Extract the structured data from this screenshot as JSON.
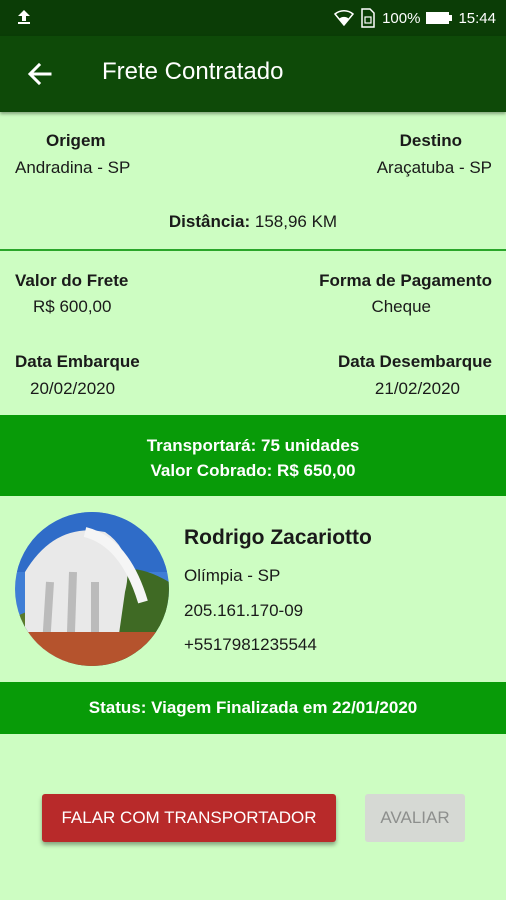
{
  "status_bar": {
    "battery": "100%",
    "time": "15:44"
  },
  "app_bar": {
    "title": "Frete Contratado"
  },
  "route": {
    "origin_label": "Origem",
    "origin_value": "Andradina - SP",
    "destination_label": "Destino",
    "destination_value": "Araçatuba - SP",
    "distance_label": "Distância:",
    "distance_value": " 158,96 KM"
  },
  "freight": {
    "value_label": "Valor do Frete",
    "value": "R$ 600,00",
    "payment_label": "Forma de Pagamento",
    "payment_value": "Cheque",
    "embark_label": "Data Embarque",
    "embark_value": "20/02/2020",
    "disembark_label": "Data Desembarque",
    "disembark_value": "21/02/2020"
  },
  "summary": {
    "transport_line": "Transportará: 75 unidades",
    "charged_line": "Valor Cobrado: R$ 650,00"
  },
  "carrier": {
    "name": "Rodrigo Zacariotto",
    "city": "Olímpia - SP",
    "document": "205.161.170-09",
    "phone": "+5517981235544"
  },
  "status": {
    "text": "Status: Viagem Finalizada em 22/01/2020"
  },
  "actions": {
    "contact_label": "FALAR COM TRANSPORTADOR",
    "rate_label": "AVALIAR"
  },
  "colors": {
    "appbar": "#0e4a08",
    "background": "#cdfdc2",
    "band": "#089b08",
    "primary_button": "#b82a2a"
  }
}
